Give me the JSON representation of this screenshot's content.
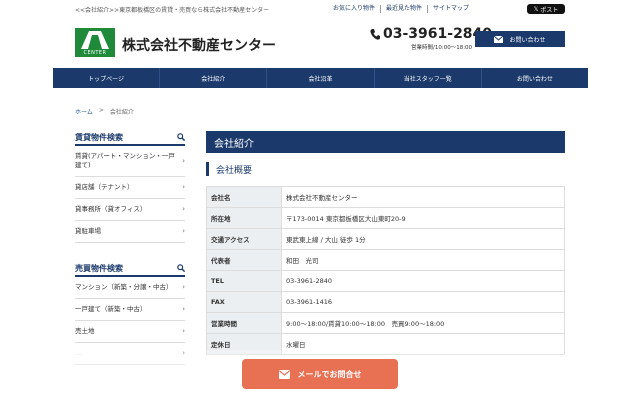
{
  "header": {
    "tagline": "<<会社紹介>>東京都板橋区の賃貸・売買なら株式会社不動産センター",
    "links": [
      "お気に入り物件",
      "最近見た物件",
      "サイトマップ"
    ],
    "xpost_label": "ポスト",
    "logo_text": "CENTER",
    "company_name": "株式会社不動産センター",
    "phone": "03-3961-2840",
    "hours": "営業時間/10:00〜18:00",
    "contact_label": "お問い合わせ"
  },
  "nav": [
    "トップページ",
    "会社紹介",
    "会社沿革",
    "当社スタッフ一覧",
    "お問い合わせ"
  ],
  "breadcrumb": {
    "home": "ホーム",
    "sep": ">",
    "current": "会社紹介"
  },
  "sidebar": {
    "rent_title": "賃貸物件検索",
    "rent_items": [
      "賃貸(アパート・マンション・一戸建て)",
      "貸店舗（テナント）",
      "貸事務所（貸オフィス）",
      "貸駐車場"
    ],
    "sale_title": "売買物件検索",
    "sale_items": [
      "マンション（新築・分譲・中古）",
      "一戸建て（新築・中古）",
      "売土地",
      "..."
    ]
  },
  "main": {
    "title": "会社紹介",
    "subtitle": "会社概要",
    "rows": [
      {
        "label": "会社名",
        "value": "株式会社不動産センター"
      },
      {
        "label": "所在地",
        "value": "〒173-0014 東京都板橋区大山東町20-9"
      },
      {
        "label": "交通アクセス",
        "value": "東武東上線 / 大山 徒歩 1分"
      },
      {
        "label": "代表者",
        "value": "和田　光司"
      },
      {
        "label": "TEL",
        "value": "03-3961-2840"
      },
      {
        "label": "FAX",
        "value": "03-3961-1416"
      },
      {
        "label": "営業時間",
        "value": "9:00〜18:00/賃貸10:00〜18:00　売買9:00〜18:00"
      },
      {
        "label": "定休日",
        "value": "水曜日"
      }
    ]
  },
  "floating": {
    "mail_label": "メールでお問合せ"
  },
  "colors": {
    "brand_navy": "#1b3a6b",
    "logo_green": "#1e8a3a",
    "cta_orange": "#e97153"
  }
}
